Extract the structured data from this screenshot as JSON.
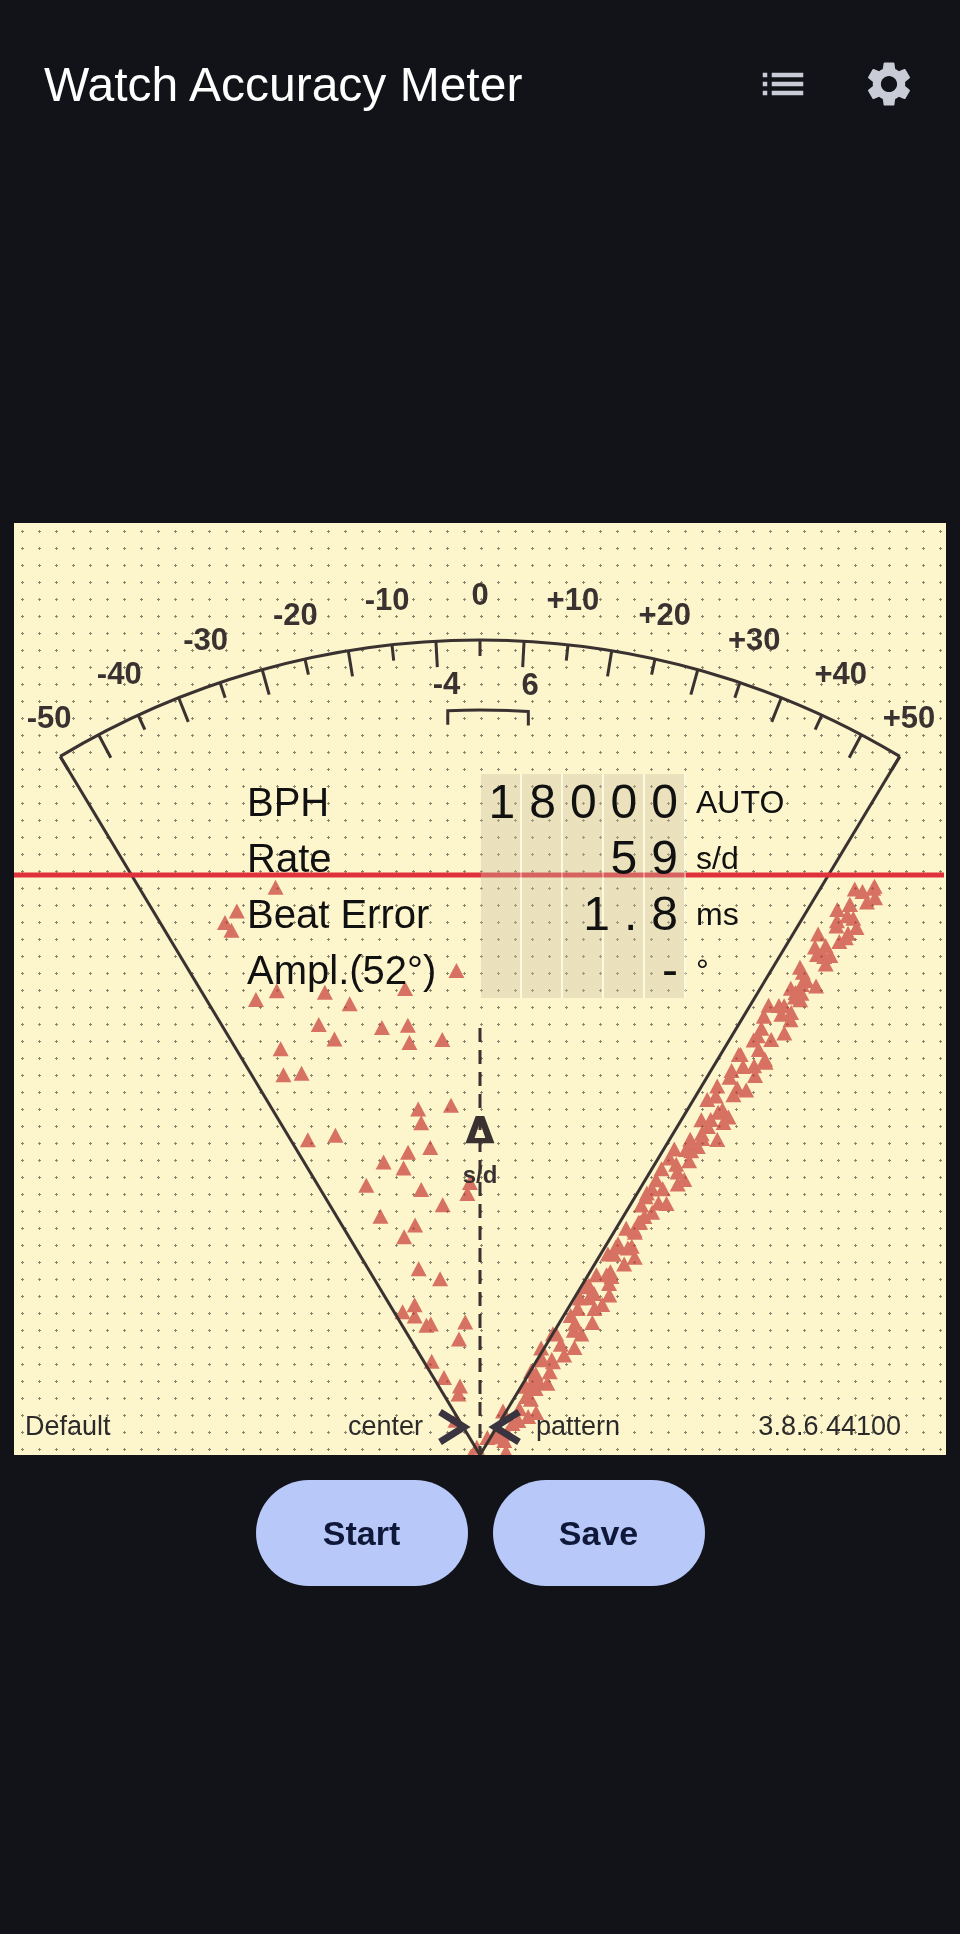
{
  "app_bar": {
    "title": "Watch Accuracy Meter"
  },
  "dial": {
    "scale_labels": [
      "-50",
      "-40",
      "-30",
      "-20",
      "-10",
      "0",
      "+10",
      "+20",
      "+30",
      "+40",
      "+50"
    ],
    "inner_labels": [
      "-4",
      "6"
    ],
    "delta_symbol": "Δ",
    "delta_unit": "s/d"
  },
  "readouts": [
    {
      "label": "BPH",
      "value": "18000",
      "unit": "AUTO"
    },
    {
      "label": "Rate",
      "value": "59",
      "unit": "s/d"
    },
    {
      "label": "Beat Error",
      "value": "1.8",
      "unit": "ms"
    },
    {
      "label": "Ampl.(52°)",
      "value": "-",
      "unit": "°"
    }
  ],
  "footer": {
    "profile": "Default",
    "left_marker": "center",
    "right_marker": "pattern",
    "version": "3.8.6 44100"
  },
  "buttons": [
    {
      "label": "Start"
    },
    {
      "label": "Save"
    }
  ]
}
